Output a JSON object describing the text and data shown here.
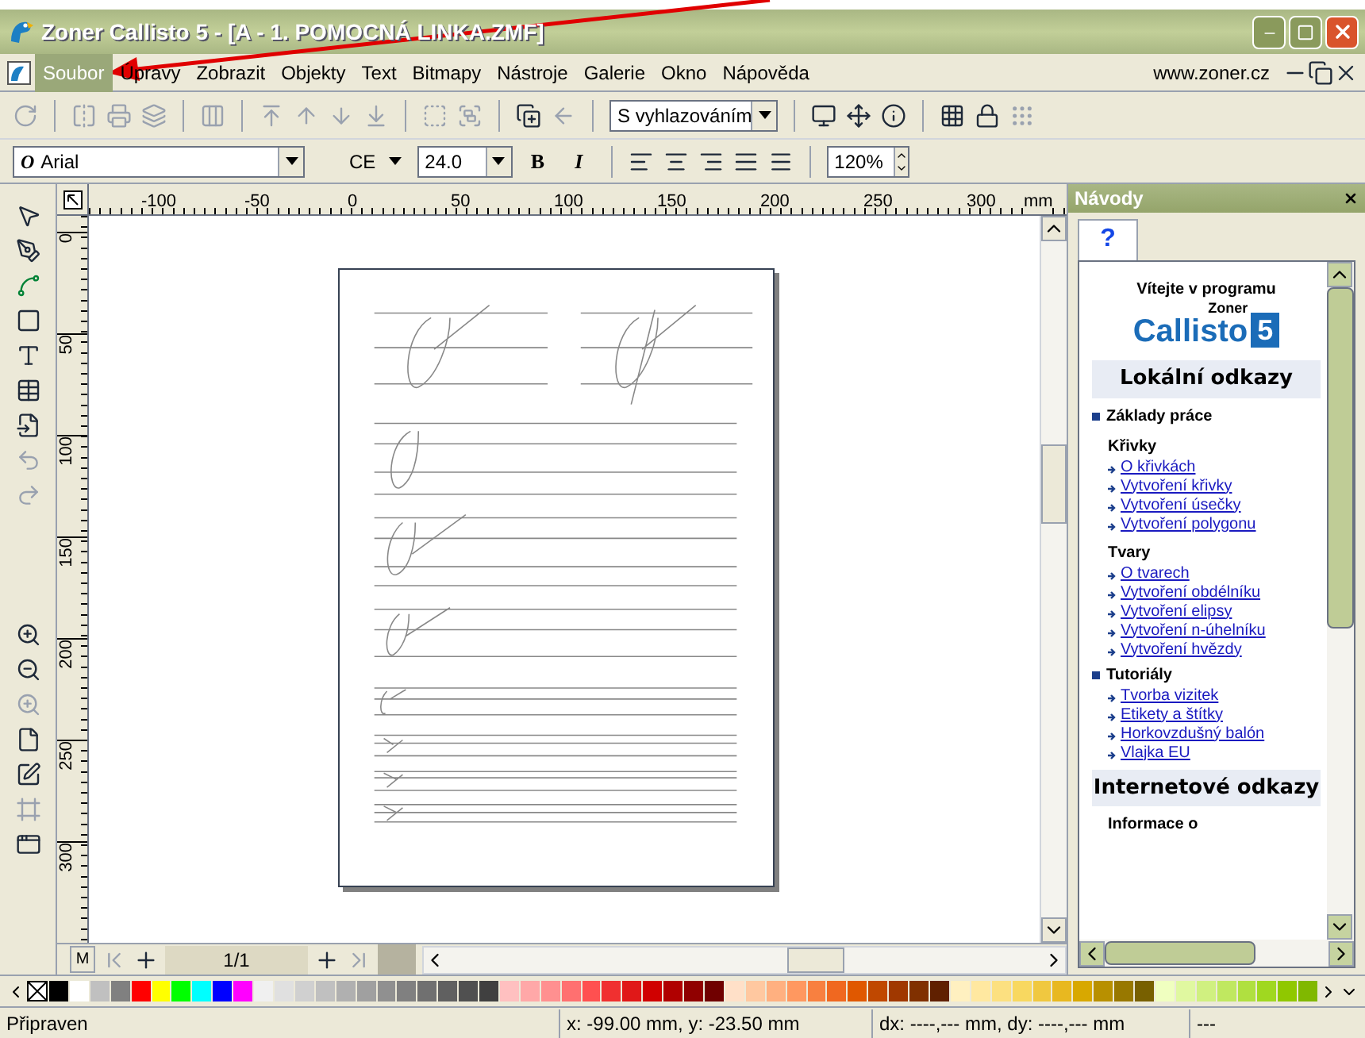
{
  "window": {
    "title": "Zoner Callisto 5 - [A - 1. POMOCNÁ LINKA.ZMF]"
  },
  "menu": {
    "items": [
      {
        "label": "Soubor",
        "selected": true
      },
      {
        "label": "Úpravy",
        "selected": false
      },
      {
        "label": "Zobrazit",
        "selected": false
      },
      {
        "label": "Objekty",
        "selected": false
      },
      {
        "label": "Text",
        "selected": false
      },
      {
        "label": "Bitmapy",
        "selected": false
      },
      {
        "label": "Nástroje",
        "selected": false
      },
      {
        "label": "Galerie",
        "selected": false
      },
      {
        "label": "Okno",
        "selected": false
      },
      {
        "label": "Nápověda",
        "selected": false
      }
    ],
    "link": "www.zoner.cz"
  },
  "toolbar": {
    "render_mode": "S vyhlazováním"
  },
  "format_bar": {
    "font_glyph": "O",
    "font": "Arial",
    "charset": "CE",
    "size": "24.0",
    "bold": "B",
    "italic": "I",
    "zoom": "120%"
  },
  "rulers": {
    "horizontal": [
      "-100",
      "-50",
      "0",
      "50",
      "100",
      "150",
      "200",
      "250",
      "300"
    ],
    "unit": "mm",
    "vertical": [
      "0",
      "50",
      "100",
      "150",
      "200",
      "250",
      "300"
    ]
  },
  "help_panel": {
    "title": "Návody",
    "tab": "?",
    "welcome": "Vítejte v programu",
    "logo_top": "Zoner",
    "logo_name": "Callisto",
    "logo_number": "5",
    "entries": [
      {
        "kind": "heading",
        "text": "Lokální odkazy"
      },
      {
        "kind": "bullet",
        "text": "Základy práce"
      },
      {
        "kind": "subheading",
        "text": "Křivky"
      },
      {
        "kind": "link",
        "text": "O křivkách"
      },
      {
        "kind": "link",
        "text": "Vytvoření křivky"
      },
      {
        "kind": "link",
        "text": "Vytvoření úsečky"
      },
      {
        "kind": "link",
        "text": "Vytvoření polygonu"
      },
      {
        "kind": "subheading",
        "text": "Tvary"
      },
      {
        "kind": "link",
        "text": "O tvarech"
      },
      {
        "kind": "link",
        "text": "Vytvoření obdélníku"
      },
      {
        "kind": "link",
        "text": "Vytvoření elipsy"
      },
      {
        "kind": "link",
        "text": "Vytvoření n-úhelníku"
      },
      {
        "kind": "link",
        "text": "Vytvoření hvězdy"
      },
      {
        "kind": "bullet",
        "text": "Tutoriály"
      },
      {
        "kind": "link",
        "text": "Tvorba vizitek"
      },
      {
        "kind": "link",
        "text": "Etikety a štítky"
      },
      {
        "kind": "link",
        "text": "Horkovzdušný balón"
      },
      {
        "kind": "link",
        "text": "Vlajka EU"
      },
      {
        "kind": "heading",
        "text": "Internetové odkazy"
      },
      {
        "kind": "subheading",
        "text": "Informace o"
      }
    ]
  },
  "page_nav": {
    "master": "M",
    "page": "1/1"
  },
  "palette": [
    {
      "color": "#000000"
    },
    {
      "color": "#ffffff"
    },
    {
      "color": "#c0c0c0"
    },
    {
      "color": "#808080"
    },
    {
      "color": "#ff0000"
    },
    {
      "color": "#ffff00"
    },
    {
      "color": "#00ff00"
    },
    {
      "color": "#00ffff"
    },
    {
      "color": "#0000ff"
    },
    {
      "color": "#ff00ff"
    },
    {
      "color": "#f0f0f0"
    },
    {
      "color": "#e0e0e0"
    },
    {
      "color": "#d0d0d0"
    },
    {
      "color": "#c0c0c0"
    },
    {
      "color": "#b0b0b0"
    },
    {
      "color": "#a0a0a0"
    },
    {
      "color": "#909090"
    },
    {
      "color": "#808080"
    },
    {
      "color": "#707070"
    },
    {
      "color": "#606060"
    },
    {
      "color": "#505050"
    },
    {
      "color": "#404040"
    },
    {
      "color": "#ffc0c0"
    },
    {
      "color": "#ffa8a8"
    },
    {
      "color": "#ff9090"
    },
    {
      "color": "#ff7070"
    },
    {
      "color": "#ff5050"
    },
    {
      "color": "#f03030"
    },
    {
      "color": "#e01818"
    },
    {
      "color": "#d00000"
    },
    {
      "color": "#b00000"
    },
    {
      "color": "#900000"
    },
    {
      "color": "#700000"
    },
    {
      "color": "#ffe0c8"
    },
    {
      "color": "#ffc8a0"
    },
    {
      "color": "#ffb080"
    },
    {
      "color": "#ff9860"
    },
    {
      "color": "#f88040"
    },
    {
      "color": "#f06820"
    },
    {
      "color": "#e05800"
    },
    {
      "color": "#c04800"
    },
    {
      "color": "#a03800"
    },
    {
      "color": "#803000"
    },
    {
      "color": "#602000"
    },
    {
      "color": "#fff0c0"
    },
    {
      "color": "#ffe8a0"
    },
    {
      "color": "#fce080"
    },
    {
      "color": "#f8d860"
    },
    {
      "color": "#f0c840"
    },
    {
      "color": "#e8b820"
    },
    {
      "color": "#d8a800"
    },
    {
      "color": "#b89000"
    },
    {
      "color": "#987800"
    },
    {
      "color": "#786000"
    },
    {
      "color": "#f0ffc0"
    },
    {
      "color": "#e0f8a0"
    },
    {
      "color": "#d0f080"
    },
    {
      "color": "#c0e860"
    },
    {
      "color": "#b0e040"
    },
    {
      "color": "#a0d820"
    },
    {
      "color": "#90c800"
    },
    {
      "color": "#80b800"
    }
  ],
  "status_bar": {
    "state": "Připraven",
    "position": "x: -99.00 mm, y: -23.50 mm",
    "delta": "dx: ----,--- mm, dy: ----,--- mm",
    "extra": "---"
  }
}
